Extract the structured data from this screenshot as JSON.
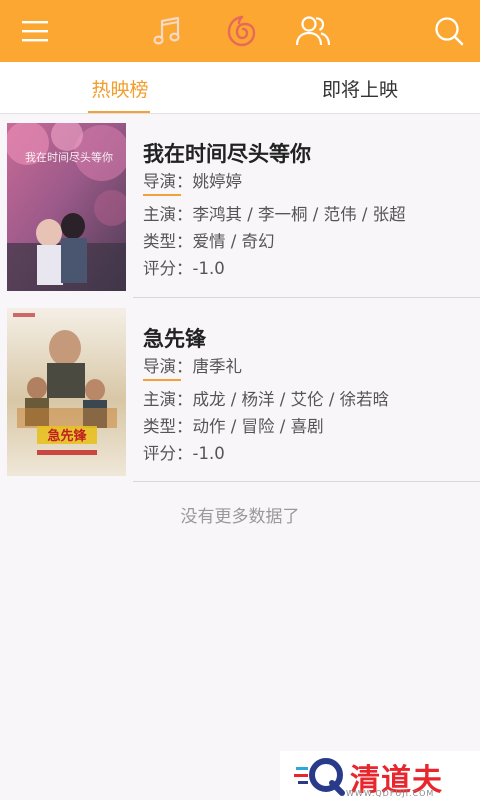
{
  "toolbar": {
    "icons": [
      "menu-icon",
      "music-note-icon",
      "radio-icon",
      "people-icon",
      "search-icon"
    ],
    "accent": "#fba732"
  },
  "tabs": [
    {
      "label": "热映榜",
      "active": true
    },
    {
      "label": "即将上映",
      "active": false
    }
  ],
  "movies": [
    {
      "title": "我在时间尽头等你",
      "director_label": "导演：",
      "director": "姚婷婷",
      "cast_label": "主演：",
      "cast": "李鸿其 / 李一桐 / 范伟 / 张超",
      "genre_label": "类型：",
      "genre": "爱情 / 奇幻",
      "score_label": "评分：",
      "score": "-1.0",
      "poster_text": "我在时间尽头等你"
    },
    {
      "title": "急先锋",
      "director_label": "导演：",
      "director": "唐季礼",
      "cast_label": "主演：",
      "cast": "成龙 / 杨洋 / 艾伦 / 徐若晗",
      "genre_label": "类型：",
      "genre": "动作 / 冒险 / 喜剧",
      "score_label": "评分：",
      "score": "-1.0",
      "poster_text": "急先锋"
    }
  ],
  "footer": {
    "no_more": "没有更多数据了"
  },
  "watermark": {
    "name": "清道夫",
    "url": "WWW.QDFUJI.COM"
  }
}
